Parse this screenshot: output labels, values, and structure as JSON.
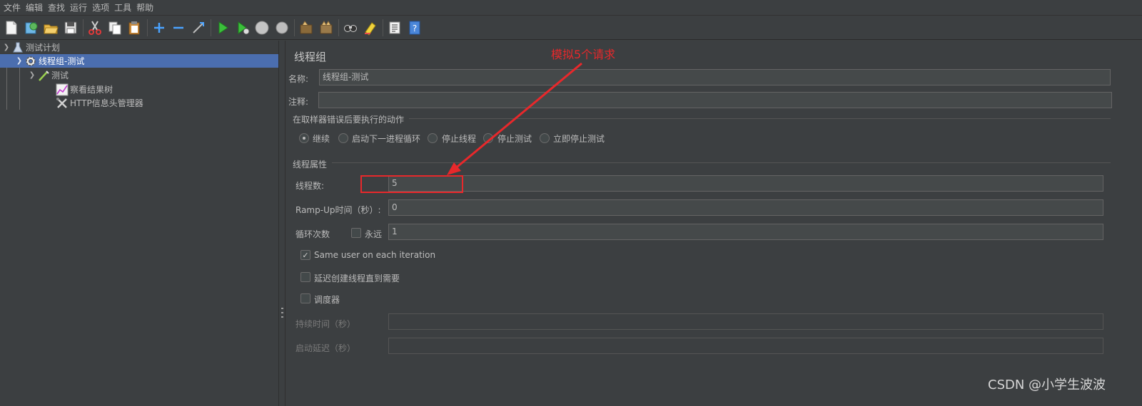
{
  "menu": [
    "文件",
    "编辑",
    "查找",
    "运行",
    "选项",
    "工具",
    "帮助"
  ],
  "toolbar": {
    "icons": [
      "new-file-icon",
      "templates-icon",
      "open-icon",
      "save-icon",
      "cut-icon",
      "copy-icon",
      "paste-icon",
      "expand-icon",
      "collapse-icon",
      "toggle-icon",
      "start-icon",
      "start-no-pause-icon",
      "stop-icon",
      "shutdown-icon",
      "clear-icon",
      "clear-all-icon",
      "search-icon",
      "reset-search-icon",
      "function-helper-icon",
      "help-icon"
    ]
  },
  "tree": {
    "test_plan": "测试计划",
    "thread_group": "线程组-测试",
    "sampler": "测试",
    "listener": "察看结果树",
    "header_manager": "HTTP信息头管理器"
  },
  "panel": {
    "title": "线程组",
    "name_label": "名称:",
    "name_value": "线程组-测试",
    "comment_label": "注释:",
    "comment_value": "",
    "error_section": "在取样器错误后要执行的动作",
    "error_actions": [
      "继续",
      "启动下一进程循环",
      "停止线程",
      "停止测试",
      "立即停止测试"
    ],
    "error_selected": 0,
    "props_section": "线程属性",
    "threads_label": "线程数:",
    "threads_value": "5",
    "rampup_label": "Ramp-Up时间（秒）:",
    "rampup_value": "0",
    "loop_label": "循环次数",
    "forever_label": "永远",
    "forever_checked": false,
    "loop_value": "1",
    "same_user_label": "Same user on each iteration",
    "same_user_checked": true,
    "delay_label": "延迟创建线程直到需要",
    "delay_checked": false,
    "scheduler_label": "调度器",
    "scheduler_checked": false,
    "duration_label": "持续时间（秒）",
    "duration_value": "",
    "startup_delay_label": "启动延迟（秒）",
    "startup_delay_value": ""
  },
  "annotation": {
    "text": "模拟5个请求",
    "color": "#e8282b"
  },
  "watermark": "CSDN @小学生波波"
}
